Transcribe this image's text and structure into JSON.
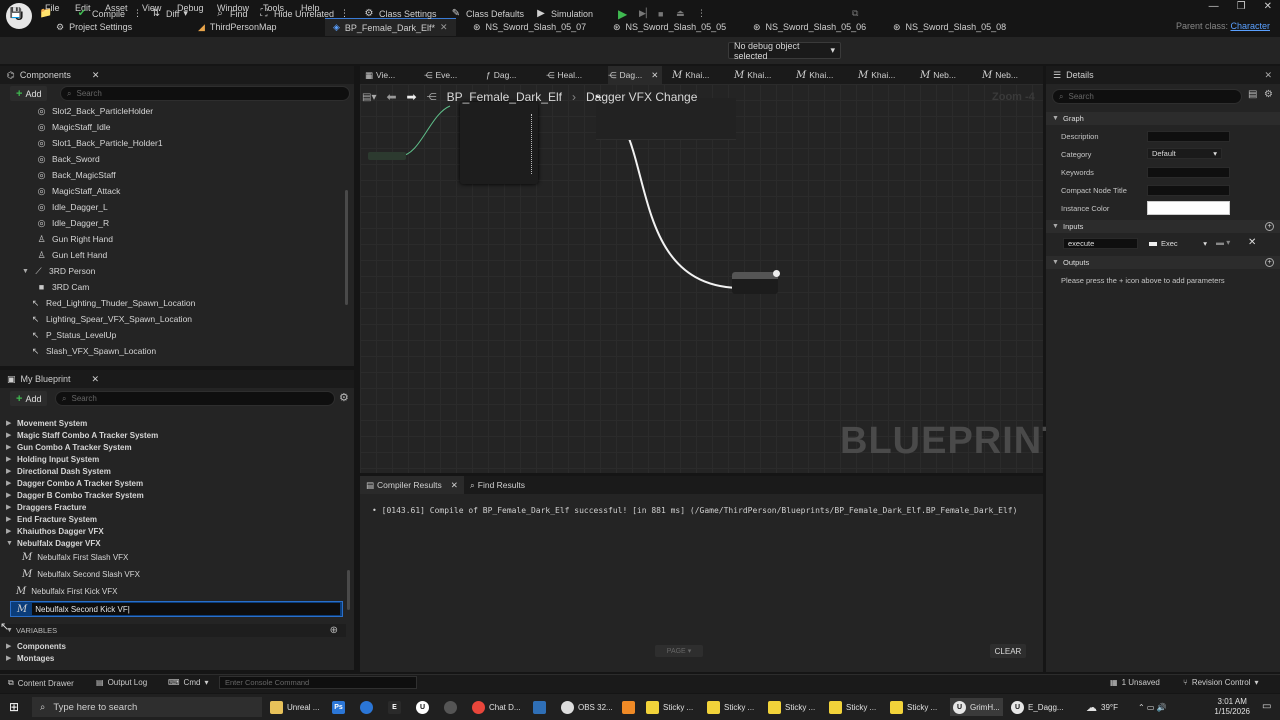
{
  "menubar": {
    "logo_text": "U",
    "items": [
      "File",
      "Edit",
      "Asset",
      "View",
      "Debug",
      "Window",
      "Tools",
      "Help"
    ],
    "window_controls": [
      "—",
      "❐",
      "✕"
    ]
  },
  "tabs": [
    {
      "label": "Project Settings"
    },
    {
      "label": "ThirdPersonMap"
    },
    {
      "label": "BP_Female_Dark_Elf*"
    },
    {
      "label": "NS_Sword_Slash_05_07"
    },
    {
      "label": "NS_Sword_Slash_05_05"
    },
    {
      "label": "NS_Sword_Slash_05_06"
    },
    {
      "label": "NS_Sword_Slash_05_08"
    }
  ],
  "parent_class": {
    "label": "Parent class:",
    "value": "Character"
  },
  "toolbar": {
    "compile": "Compile",
    "diff": "Diff",
    "find": "Find",
    "hide_unrelated": "Hide Unrelated",
    "class_settings": "Class Settings",
    "class_defaults": "Class Defaults",
    "simulation": "Simulation",
    "debug_select": "No debug object selected"
  },
  "components": {
    "title": "Components",
    "add_label": "Add",
    "search_placeholder": "Search",
    "items": [
      {
        "label": "Slot2_Back_ParticleHolder",
        "icon": "sphere-icon"
      },
      {
        "label": "MagicStaff_Idle",
        "icon": "sphere-icon"
      },
      {
        "label": "Slot1_Back_Particle_Holder1",
        "icon": "sphere-icon"
      },
      {
        "label": "Back_Sword",
        "icon": "sphere-icon"
      },
      {
        "label": "Back_MagicStaff",
        "icon": "sphere-icon"
      },
      {
        "label": "MagicStaff_Attack",
        "icon": "sphere-icon"
      },
      {
        "label": "Idle_Dagger_L",
        "icon": "sphere-icon"
      },
      {
        "label": "Idle_Dagger_R",
        "icon": "sphere-icon"
      },
      {
        "label": "Gun Right Hand",
        "icon": "person-icon"
      },
      {
        "label": "Gun Left Hand",
        "icon": "person-icon"
      },
      {
        "label": "3RD Person",
        "icon": "arm-icon"
      },
      {
        "label": "3RD Cam",
        "icon": "camera-icon"
      },
      {
        "label": "Red_Lighting_Thuder_Spawn_Location",
        "icon": "arrow-icon"
      },
      {
        "label": "Lighting_Spear_VFX_Spawn_Location",
        "icon": "arrow-icon"
      },
      {
        "label": "P_Status_LevelUp",
        "icon": "arrow-icon"
      },
      {
        "label": "Slash_VFX_Spawn_Location",
        "icon": "arrow-icon"
      }
    ]
  },
  "my_blueprint": {
    "title": "My Blueprint",
    "add_label": "Add",
    "search_placeholder": "Search",
    "categories": [
      "Movement System",
      "Magic Staff Combo A Tracker System",
      "Gun Combo A Tracker System",
      "Holding Input System",
      "Directional Dash System",
      "Dagger Combo A Tracker System",
      "Dagger B Combo Tracker System",
      "Draggers Fracture",
      "End Fracture System",
      "Khaiuthos Dagger VFX",
      "Nebulfalx Dagger VFX"
    ],
    "macros": [
      "Nebulfalx First Slash VFX",
      "Nebulfalx Second Slash VFX",
      "Nebulfalx First Kick VFX"
    ],
    "rename_value": "Nebulfalx Second Kick VF",
    "variables_label": "VARIABLES",
    "variable_groups": [
      "Components",
      "Montages"
    ]
  },
  "graph": {
    "tabs": [
      "Vie...",
      "Eve...",
      "Dag...",
      "Heal...",
      "Dag...",
      "Khai...",
      "Khai...",
      "Khai...",
      "Khai...",
      "Neb...",
      "Neb..."
    ],
    "breadcrumb_root": "BP_Female_Dark_Elf",
    "breadcrumb_current": "Dagger VFX Change",
    "zoom": "Zoom -4",
    "watermark": "BLUEPRINT"
  },
  "compiler": {
    "tab_results": "Compiler Results",
    "tab_find": "Find Results",
    "message": "• [0143.61] Compile of BP_Female_Dark_Elf successful! [in 881 ms] (/Game/ThirdPerson/Blueprints/BP_Female_Dark_Elf.BP_Female_Dark_Elf)",
    "page_label": "PAGE",
    "clear_label": "CLEAR"
  },
  "details": {
    "title": "Details",
    "search_placeholder": "Search",
    "graph_section": "Graph",
    "fields": {
      "description": "Description",
      "category": "Category",
      "category_value": "Default",
      "keywords": "Keywords",
      "compact_title": "Compact Node Title",
      "instance_color": "Instance Color"
    },
    "inputs_section": "Inputs",
    "input_name": "execute",
    "input_type": "Exec",
    "outputs_section": "Outputs",
    "outputs_hint": "Please press the + icon above to add parameters"
  },
  "statusbar": {
    "content_drawer": "Content Drawer",
    "output_log": "Output Log",
    "cmd": "Cmd",
    "console_placeholder": "Enter Console Command",
    "unsaved": "1 Unsaved",
    "revision": "Revision Control"
  },
  "taskbar": {
    "search_placeholder": "Type here to search",
    "apps": [
      {
        "label": "Unreal ...",
        "color": "#e8c25a"
      },
      {
        "label": "",
        "color": "#2b76d6"
      },
      {
        "label": "",
        "color": "#2b76d6"
      },
      {
        "label": "",
        "color": "#2a2a2a"
      },
      {
        "label": "",
        "color": "#ffffff"
      },
      {
        "label": "Chat D...",
        "color": "#e9463b"
      },
      {
        "label": "",
        "color": "#2f6fb6"
      },
      {
        "label": "OBS 32...",
        "color": "#dddddd"
      },
      {
        "label": "",
        "color": "#ef8a26"
      },
      {
        "label": "",
        "color": "#cccccc"
      },
      {
        "label": "Sticky ...",
        "color": "#f2d33a"
      },
      {
        "label": "Sticky ...",
        "color": "#f2d33a"
      },
      {
        "label": "Sticky ...",
        "color": "#f2d33a"
      },
      {
        "label": "Sticky ...",
        "color": "#f2d33a"
      },
      {
        "label": "Sticky ...",
        "color": "#f2d33a"
      },
      {
        "label": "GrimH...",
        "color": "#e6e6e6"
      },
      {
        "label": "E_Dagg...",
        "color": "#e6e6e6"
      }
    ],
    "weather": "39°F",
    "time": "3:01 AM",
    "date": "1/15/2026"
  }
}
